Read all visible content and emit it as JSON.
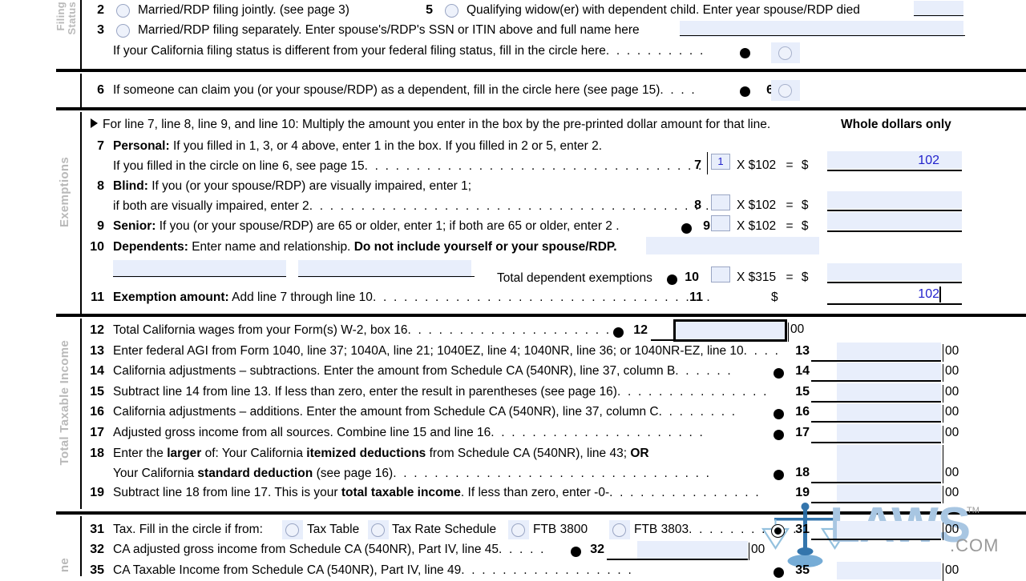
{
  "form": {
    "watermark": {
      "text": "LAWS",
      "suffix": ".COM",
      "tm": "TM",
      "icon": "scales-of-justice-icon",
      "color": "#a8c6e2"
    }
  },
  "sections": {
    "filing_status": {
      "label": "Filing\nStatus",
      "label_line1": "Filing",
      "label_line2": "Status"
    },
    "exemptions": {
      "label": "Exemptions"
    },
    "total_taxable_income": {
      "label": "Total Taxable Income"
    },
    "tax_section": {
      "label": "ne"
    }
  },
  "filing_status": {
    "line2": {
      "number": "2",
      "text": "Married/RDP filing jointly. (see page 3)"
    },
    "line5": {
      "number": "5",
      "text": "Qualifying widow(er) with dependent child. Enter year spouse/RDP died",
      "value": ""
    },
    "line3": {
      "number": "3",
      "text": "Married/RDP filing separately. Enter spouse's/RDP's SSN or ITIN above and full name here",
      "value": ""
    },
    "note": {
      "text": "If your California filing status is different from your federal filing status, fill in the circle here",
      "dots": ". . . . . . . . . ."
    }
  },
  "line6": {
    "number": "6",
    "text": "If someone can claim you (or your spouse/RDP) as a dependent, fill in the circle here (see page 15)",
    "dots": ". . . .",
    "ref": "6"
  },
  "exemptions": {
    "instruction": "For line 7, line 8, line 9, and line 10: Multiply the amount you enter in the box by the pre-printed dollar amount for that line.",
    "whole_dollars": "Whole dollars only",
    "line7": {
      "number": "7",
      "label": "Personal:",
      "text1": "If you filled in 1, 3, or 4 above, enter 1 in the box. If you filled in 2 or 5, enter 2.",
      "text2": "If you filled in the circle on line 6, see page 15",
      "dots": ". . . . . . . . . . . . . . . . . . . . . . . . . . . . . . . . .",
      "ref": "7",
      "count": "1",
      "multiplier": "X $102",
      "equals": "=",
      "dollar": "$",
      "amount": "102"
    },
    "line8": {
      "number": "8",
      "label": "Blind:",
      "text1": "If you (or your spouse/RDP) are visually impaired, enter 1;",
      "text2": "if both are visually impaired, enter 2",
      "dots": ". . . . . . . . . . . . . . . . . . . . . . . . . . . . . . . . . . . . . . .",
      "ref": "8",
      "count": "",
      "multiplier": "X $102",
      "equals": "=",
      "dollar": "$",
      "amount": ""
    },
    "line9": {
      "number": "9",
      "label": "Senior:",
      "text1": "If you (or your spouse/RDP) are 65 or older, enter 1; if both are 65 or older, enter 2 .",
      "ref": "9",
      "count": "",
      "multiplier": "X $102",
      "equals": "=",
      "dollar": "$",
      "amount": ""
    },
    "line10": {
      "number": "10",
      "label": "Dependents:",
      "text1": "Enter name and relationship.",
      "text2": "Do not include yourself or your spouse/RDP.",
      "total_label": "Total dependent exemptions",
      "ref": "10",
      "count": "",
      "multiplier": "X $315",
      "equals": "=",
      "dollar": "$",
      "amount": "",
      "dependent1": "",
      "dependent2": "",
      "dependent3": ""
    },
    "line11": {
      "number": "11",
      "label": "Exemption amount:",
      "text": "Add line 7 through line 10",
      "dots": ". . . . . . . . . . . . . . . . . . . . . . . . . . . . . . . . .",
      "ref": "11",
      "dollar": "$",
      "amount": "102"
    }
  },
  "income": {
    "line12": {
      "number": "12",
      "text": "Total California wages from your Form(s) W-2, box 16",
      "dots": ". . . . . . . . . . . . . . . . . . . . .",
      "ref": "12",
      "value": "",
      "cents": "00",
      "focused": true
    },
    "line13": {
      "number": "13",
      "text": "Enter federal AGI from Form 1040, line 37; 1040A, line 21; 1040EZ, line 4; 1040NR, line 36; or 1040NR-EZ, line 10",
      "dots": ". . . .",
      "ref": "13",
      "value": "",
      "cents": "00"
    },
    "line14": {
      "number": "14",
      "text": "California adjustments – subtractions. Enter the amount from Schedule CA (540NR), line 37, column B",
      "dots": ". . . . . .",
      "ref": "14",
      "value": "",
      "cents": "00"
    },
    "line15": {
      "number": "15",
      "text": "Subtract line 14 from line 13. If less than zero, enter the result in parentheses (see page 16)",
      "dots": ". . . . . . . . . . . . . . .",
      "ref": "15",
      "value": "",
      "cents": "00"
    },
    "line16": {
      "number": "16",
      "text": "California adjustments – additions. Enter the amount from Schedule CA (540NR), line 37, column C",
      "dots": ". . . . . . . .",
      "ref": "16",
      "value": "",
      "cents": "00"
    },
    "line17": {
      "number": "17",
      "text": "Adjusted gross income from all sources. Combine line 15 and line 16",
      "dots": ". . . . . . . . . . . . . . . . . . . . .",
      "ref": "17",
      "value": "",
      "cents": "00"
    },
    "line18": {
      "number": "18",
      "text_a_1": "Enter the",
      "text_a_2": "larger",
      "text_a_3": "of: Your California",
      "text_a_4": "itemized deductions",
      "text_a_5": "from Schedule CA (540NR), line 43;",
      "text_a_6": "OR",
      "text_b_1": "Your California",
      "text_b_2": "standard deduction",
      "text_b_3": "(see page 16)",
      "dots": ". . . . . . . . . . . . . . . . . . . . . . . . . . . . . . .",
      "ref": "18",
      "value": "",
      "cents": "00"
    },
    "line19": {
      "number": "19",
      "text_1": "Subtract line 18 from line 17. This is your",
      "text_2": "total taxable income",
      "text_3": ". If less than zero, enter -0-",
      "dots": ". . . . . . . . . . . . . . .",
      "ref": "19",
      "value": "",
      "cents": "00"
    }
  },
  "tax": {
    "line31": {
      "number": "31",
      "text": "Tax. Fill in the circle if from:",
      "options": [
        "Tax Table",
        "Tax Rate Schedule",
        "FTB 3800",
        "FTB 3803"
      ],
      "dots": ". . . . . . . . . . . .",
      "ref": "31",
      "value": "",
      "cents": "00",
      "selected": true
    },
    "line32": {
      "number": "32",
      "text": "CA adjusted gross income from Schedule CA (540NR), Part IV, line 45",
      "dots": ". . . . .",
      "ref": "32",
      "value": "",
      "cents": "00"
    },
    "line35": {
      "number": "35",
      "text": "CA Taxable Income from Schedule CA (540NR), Part IV, line 49",
      "dots": ". . . . . . . . . . . . . . . . .",
      "ref": "35",
      "value": "",
      "cents": "00"
    }
  }
}
